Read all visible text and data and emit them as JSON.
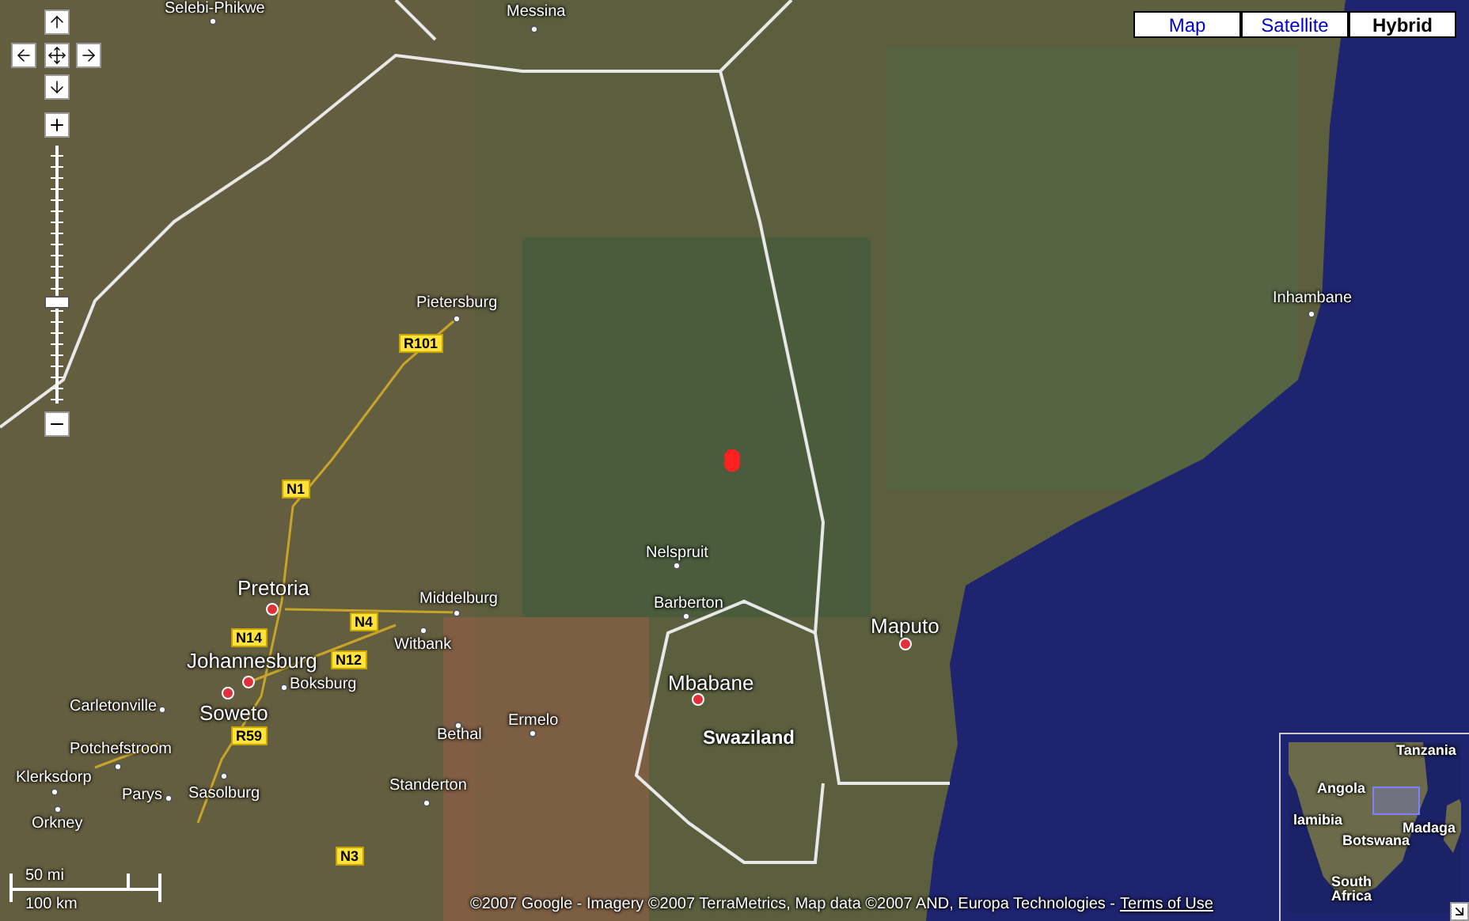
{
  "map_type_buttons": [
    {
      "label": "Map",
      "selected": false
    },
    {
      "label": "Satellite",
      "selected": false
    },
    {
      "label": "Hybrid",
      "selected": true
    }
  ],
  "zoom": {
    "level": 0.39
  },
  "labels": [
    {
      "kind": "city",
      "text": "Selebi-Phikwe"
    },
    {
      "kind": "city",
      "text": "Messina"
    },
    {
      "kind": "city",
      "text": "Pietersburg"
    },
    {
      "kind": "city",
      "text": "Inhambane"
    },
    {
      "kind": "city",
      "text": "Nelspruit"
    },
    {
      "kind": "city",
      "text": "Barberton"
    },
    {
      "kind": "city",
      "text": "Middelburg"
    },
    {
      "kind": "city",
      "text": "Witbank"
    },
    {
      "kind": "city",
      "text": "Boksburg"
    },
    {
      "kind": "city",
      "text": "Carletonville"
    },
    {
      "kind": "city",
      "text": "Potchefstroom"
    },
    {
      "kind": "city",
      "text": "Klerksdorp"
    },
    {
      "kind": "city",
      "text": "Orkney"
    },
    {
      "kind": "city",
      "text": "Parys"
    },
    {
      "kind": "city",
      "text": "Sasolburg"
    },
    {
      "kind": "city",
      "text": "Bethal"
    },
    {
      "kind": "city",
      "text": "Ermelo"
    },
    {
      "kind": "city",
      "text": "Standerton"
    },
    {
      "kind": "capital",
      "text": "Pretoria"
    },
    {
      "kind": "capital",
      "text": "Johannesburg"
    },
    {
      "kind": "capital",
      "text": "Soweto"
    },
    {
      "kind": "capital",
      "text": "Maputo"
    },
    {
      "kind": "capital",
      "text": "Mbabane"
    },
    {
      "kind": "country",
      "text": "Swaziland"
    },
    {
      "kind": "road",
      "text": "R101"
    },
    {
      "kind": "road",
      "text": "N1"
    },
    {
      "kind": "road",
      "text": "N14"
    },
    {
      "kind": "road",
      "text": "N4"
    },
    {
      "kind": "road",
      "text": "N12"
    },
    {
      "kind": "road",
      "text": "R59"
    },
    {
      "kind": "road",
      "text": "N3"
    }
  ],
  "scale": {
    "miles": "50 mi",
    "km": "100 km"
  },
  "copyright": "©2007 Google - Imagery ©2007 TerraMetrics, Map data ©2007 AND, Europa Technologies -",
  "terms_link": "Terms of Use",
  "overview": {
    "labels": [
      "Tanzania",
      "Angola",
      "lamibia",
      "Botswana",
      "Madaga",
      "South Africa"
    ]
  }
}
